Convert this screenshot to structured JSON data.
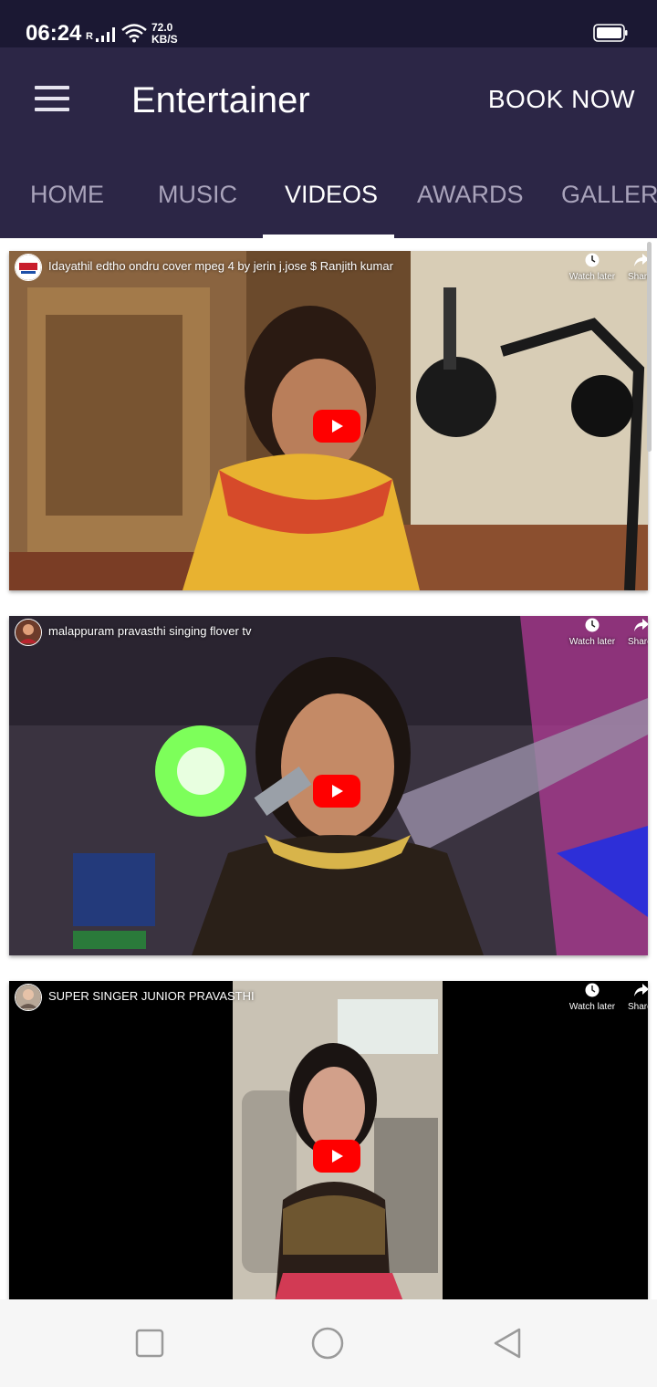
{
  "status_bar": {
    "time": "06:24",
    "network_label": "R",
    "speed_value": "72.0",
    "speed_unit": "KB/S",
    "icons": [
      "signal-icon",
      "wifi-icon",
      "battery-icon"
    ]
  },
  "app_bar": {
    "menu_icon": "hamburger-menu-icon",
    "title": "Entertainer",
    "book_label": "BOOK NOW"
  },
  "tabs": [
    {
      "label": "HOME",
      "active": false
    },
    {
      "label": "MUSIC",
      "active": false
    },
    {
      "label": "VIDEOS",
      "active": true
    },
    {
      "label": "AWARDS",
      "active": false
    },
    {
      "label": "GALLERY",
      "active": false
    }
  ],
  "videos": [
    {
      "title": "Idayathil edtho ondru cover mpeg 4 by jerin j.jose $ Ranjith kumar",
      "watch_later": "Watch later",
      "share": "Share"
    },
    {
      "title": "malappuram pravasthi singing flover tv",
      "watch_later": "Watch later",
      "share": "Share"
    },
    {
      "title": "SUPER SINGER JUNIOR PRAVASTHI",
      "watch_later": "Watch later",
      "share": "Share"
    }
  ],
  "nav_bar": {
    "icons": [
      "recent-apps-icon",
      "home-icon",
      "back-icon"
    ]
  },
  "colors": {
    "status_bar": "#1b1833",
    "app_bar": "#2c2646",
    "tab_inactive": "#a9a3bb",
    "tab_active": "#ffffff",
    "youtube_red": "#ff0000"
  }
}
